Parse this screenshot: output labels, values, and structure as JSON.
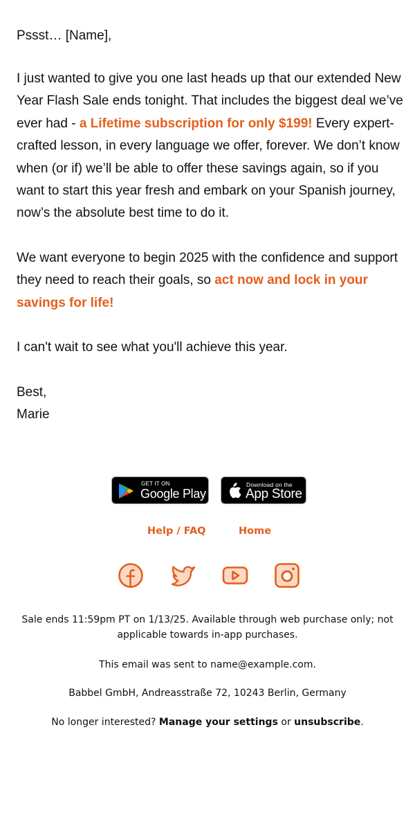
{
  "email": {
    "greeting": "Pssst… [Name],",
    "paragraph1": {
      "before": "I just wanted to give you one last heads up that our extended New Year Flash Sale ends tonight. That includes the biggest deal we’ve ever had - ",
      "highlight": "a Lifetime subscription for only $199!",
      "after": " Every expert-crafted lesson, in every language we offer, forever. We don’t know when (or if) we’ll be able to offer these savings again, so if you want to start this year fresh and embark on your Spanish journey, now’s the absolute best time to do it."
    },
    "paragraph2": {
      "before": "We want everyone to begin 2025 with the confidence and support they need to reach their goals, so ",
      "highlight": "act now and lock in your savings for life!"
    },
    "paragraph3": "I can't wait to see what you'll achieve this year.",
    "signoff": "Best,",
    "signature": "Marie"
  },
  "badges": {
    "google_play": {
      "small": "GET IT ON",
      "big": "Google Play",
      "icon": "google-play-icon"
    },
    "app_store": {
      "small": "Download on the",
      "big": "App Store",
      "icon": "apple-icon"
    }
  },
  "links": {
    "help": "Help / FAQ",
    "home": "Home"
  },
  "social": [
    {
      "name": "facebook",
      "icon": "facebook-icon"
    },
    {
      "name": "twitter",
      "icon": "twitter-icon"
    },
    {
      "name": "youtube",
      "icon": "youtube-icon"
    },
    {
      "name": "instagram",
      "icon": "instagram-icon"
    }
  ],
  "footer": {
    "sale_notice": "Sale ends 11:59pm PT on 1/13/25. Available through web purchase only; not applicable towards in-app purchases.",
    "sent_to": "This email was sent to name@example.com.",
    "address": "Babbel GmbH, Andreasstraße 72, 10243 Berlin, Germany",
    "unsubscribe_prefix": "No longer interested? ",
    "manage_settings": "Manage your settings",
    "or": " or ",
    "unsubscribe": "unsubscribe",
    "period": "."
  },
  "colors": {
    "accent": "#e35f1c",
    "accent_fill": "#fcd9c5",
    "text": "#111111",
    "background": "#ffffff"
  }
}
